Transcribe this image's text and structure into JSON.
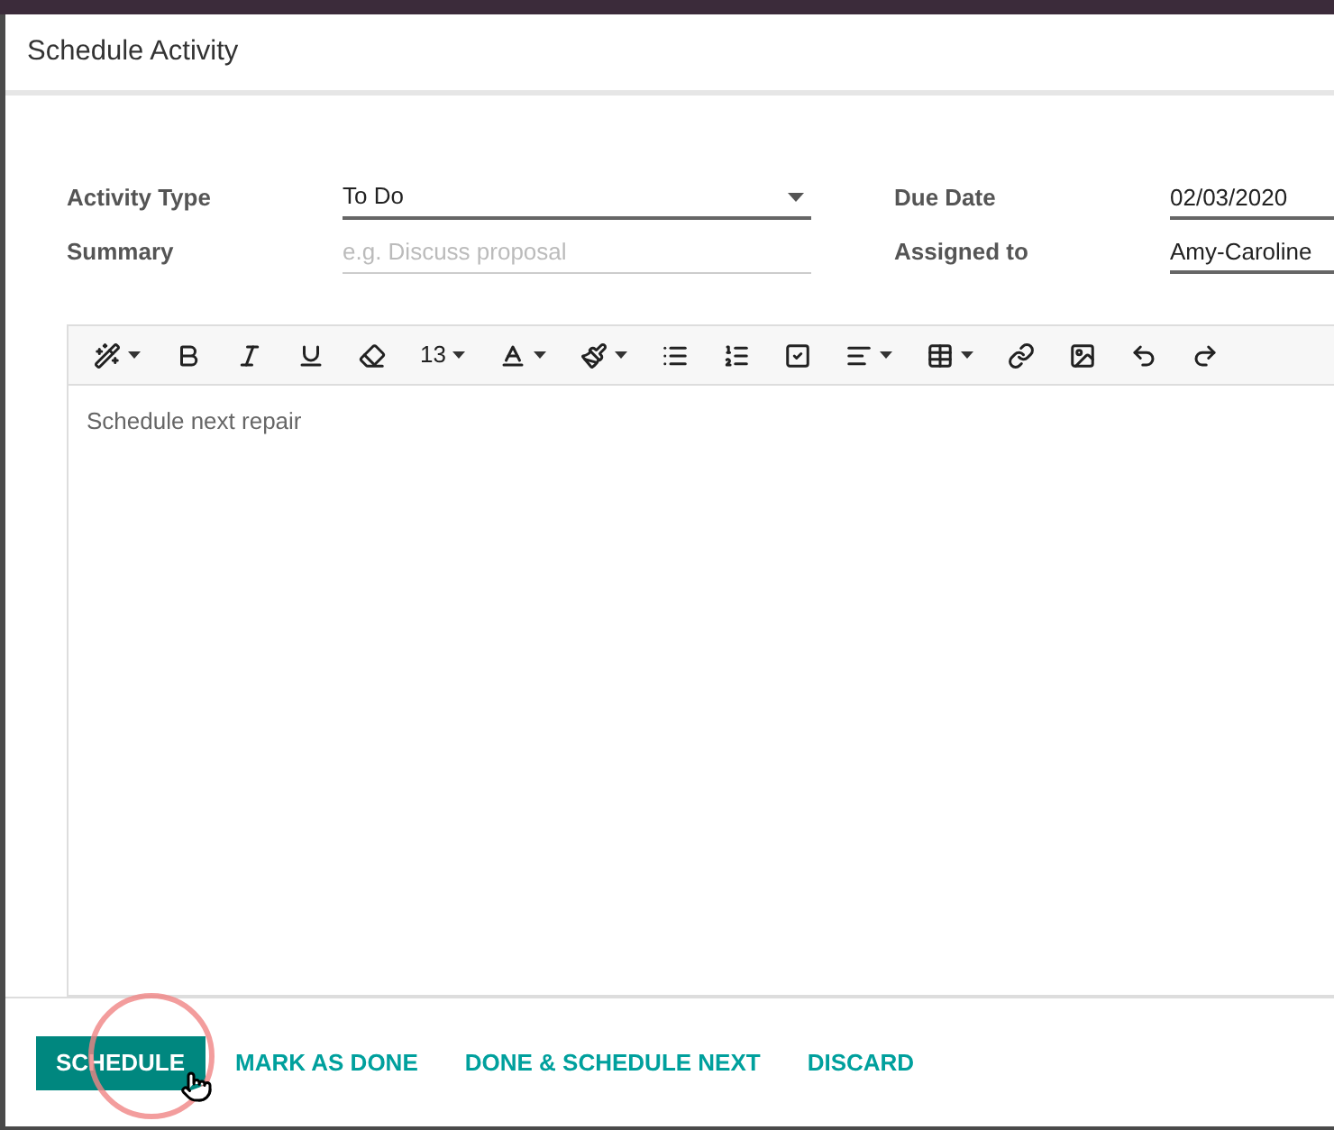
{
  "dialog": {
    "title": "Schedule Activity"
  },
  "fields": [
    {
      "label": "Activity Type",
      "value": "To Do",
      "kind": "select"
    },
    {
      "label": "Summary",
      "placeholder": "e.g. Discuss proposal",
      "kind": "text"
    },
    {
      "label": "Due Date",
      "value": "02/03/2020",
      "kind": "text"
    },
    {
      "label": "Assigned to",
      "value": "Amy-Caroline",
      "kind": "text"
    }
  ],
  "editor": {
    "font_size": "13",
    "content": "Schedule next repair"
  },
  "buttons": [
    {
      "label": "SCHEDULE",
      "kind": "primary"
    },
    {
      "label": "MARK AS DONE",
      "kind": "link"
    },
    {
      "label": "DONE & SCHEDULE NEXT",
      "kind": "link"
    },
    {
      "label": "DISCARD",
      "kind": "link"
    }
  ]
}
